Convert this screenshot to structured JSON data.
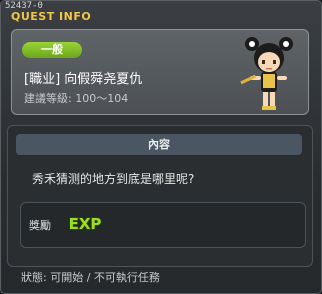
{
  "window": {
    "quest_id": "52437-0",
    "title": "QUEST INFO"
  },
  "quest": {
    "category_badge": "一般",
    "name": "[職业] 向假舜尧夏仇",
    "level": "建議等級: 100～104",
    "avatar_icon": "female-character-sprite"
  },
  "content": {
    "header": "內容",
    "description": "秀禾猜测的地方到底是哪里呢?"
  },
  "reward": {
    "label": "獎勵",
    "icon": "exp-icon",
    "icon_text": "EXP",
    "icon_color": "#9be01c"
  },
  "status": {
    "text": "狀態:  可開始 / 不可執行任務"
  },
  "colors": {
    "title": "#f2c646",
    "badge": "#7fbf27",
    "content_header": "#4a5763"
  }
}
